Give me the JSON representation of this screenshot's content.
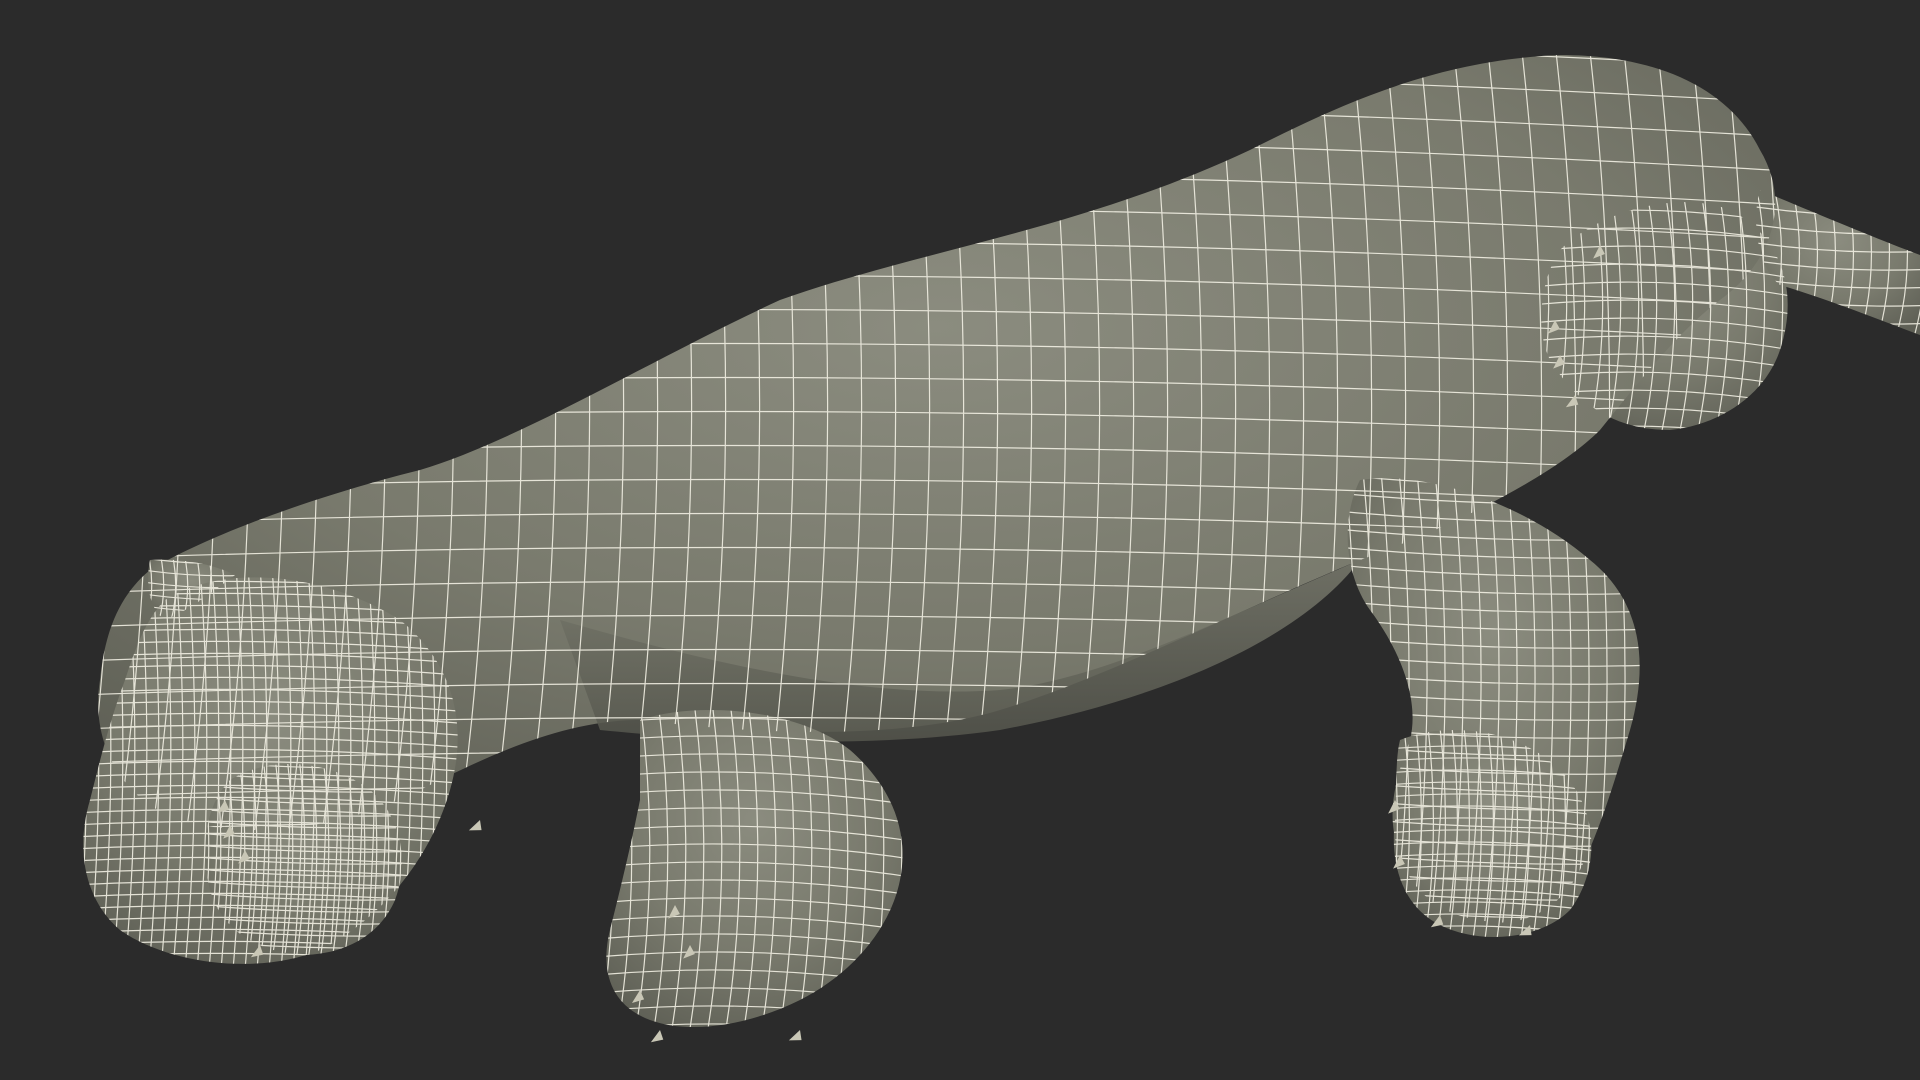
{
  "viewport": {
    "background_color": "#2b2b2b",
    "subject": "wireframe-cat-model"
  },
  "model": {
    "surface_color": "#7a7b6e",
    "surface_shadow_color": "#5c5d53",
    "surface_highlight_color": "#8e8f82",
    "wire_color": "#f2f0e4",
    "claw_color": "#c9c7b6"
  }
}
